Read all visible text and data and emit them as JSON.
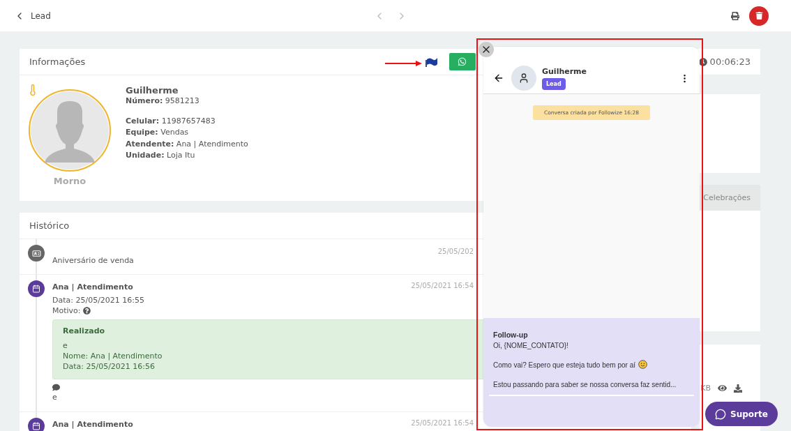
{
  "topbar": {
    "title": "Lead"
  },
  "info": {
    "title": "Informações",
    "timer": "00:06:23",
    "name": "Guilherme",
    "temperature": "Morno",
    "primary_fields": [
      {
        "label": "Número:",
        "value": "9581213"
      }
    ],
    "fields": [
      {
        "label": "Celular:",
        "value": "11987657483"
      },
      {
        "label": "Equipe:",
        "value": "Vendas"
      },
      {
        "label": "Atendente:",
        "value": "Ana | Atendimento"
      },
      {
        "label": "Unidade:",
        "value": "Loja Itu"
      }
    ]
  },
  "history": {
    "title": "Histórico",
    "items": [
      {
        "kind": "anniversary",
        "title": "Aniversário de venda",
        "date": "25/05/202"
      },
      {
        "kind": "task",
        "title": "Ana | Atendimento",
        "date": "25/05/2021 16:54",
        "detail": "Data: 25/05/2021 16:55",
        "reason": "Motivo:",
        "result": {
          "title": "Realizado",
          "lines": [
            "e",
            "Nome: Ana | Atendimento",
            "Data: 25/05/2021 16:56"
          ]
        },
        "comment": "e"
      },
      {
        "kind": "task",
        "title": "Ana | Atendimento",
        "date": "25/05/2021 16:54"
      }
    ]
  },
  "side": {
    "tab": "Celebrações",
    "attachment_size": "KB"
  },
  "chat": {
    "name": "Guilherme",
    "badge": "Lead",
    "system_message": "Conversa criada por Followize 16:28",
    "template": {
      "title": "Follow-up",
      "greeting": "Oi, {NOME_CONTATO}!",
      "paragraphs": [
        "Como vai? Espero que esteja tudo bem por aí",
        "Estou passando para saber se nossa conversa faz sentid..."
      ]
    }
  },
  "support_button": "Suporte"
}
